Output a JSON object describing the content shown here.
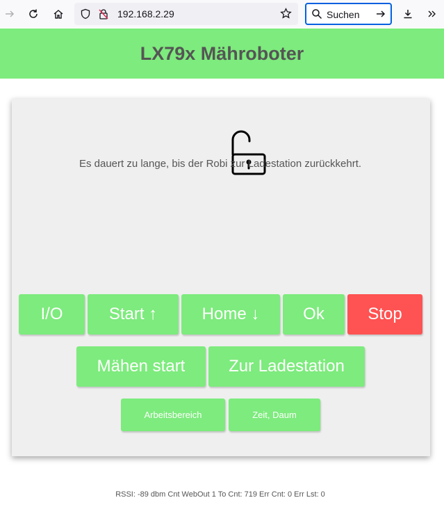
{
  "browser": {
    "url": "192.168.2.29",
    "search_placeholder": "Suchen"
  },
  "header": {
    "title": "LX79x Mähroboter"
  },
  "status": {
    "lock_state": "unlocked",
    "message": "Es dauert zu lange, bis der Robi zur Ladestation zurückkehrt."
  },
  "buttons": {
    "io": "I/O",
    "start": "Start ↑",
    "home": "Home ↓",
    "ok": "Ok",
    "stop": "Stop",
    "mow_start": "Mähen start",
    "to_station": "Zur Ladestation",
    "work_area": "Arbeitsbereich",
    "time_date": "Zeit, Daum"
  },
  "footer": {
    "text": "RSSI: -89 dbm Cnt WebOut 1 To Cnt: 719 Err Cnt: 0 Err Lst: 0"
  },
  "colors": {
    "accent_green": "#7deb7d",
    "stop_red": "#ff5252",
    "card_bg": "#efefef",
    "text_gray": "#555555"
  }
}
